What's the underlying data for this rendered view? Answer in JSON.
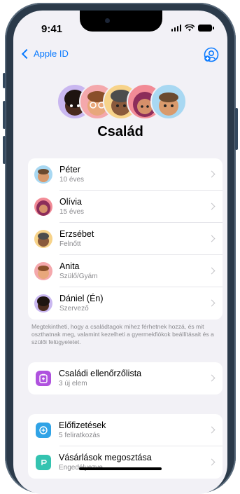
{
  "status_bar": {
    "time": "9:41"
  },
  "nav": {
    "back_label": "Apple ID"
  },
  "page": {
    "title": "Család"
  },
  "members": [
    {
      "name": "Péter",
      "detail": "10 éves"
    },
    {
      "name": "Olívia",
      "detail": "15 éves"
    },
    {
      "name": "Erzsébet",
      "detail": "Felnőtt"
    },
    {
      "name": "Anita",
      "detail": "Szülő/Gyám"
    },
    {
      "name": "Dániel (Én)",
      "detail": "Szervező"
    }
  ],
  "footnote": "Megtekintheti, hogy a családtagok mihez férhetnek hozzá, és mit oszthatnak meg, valamint kezelheti a gyermekfiókok beállításait és a szülői felügyeletet.",
  "checklist": {
    "title": "Családi ellenőrzőlista",
    "detail": "3 új elem"
  },
  "subscriptions": {
    "title": "Előfizetések",
    "detail": "5 feliratkozás"
  },
  "purchases": {
    "title": "Vásárlások megosztása",
    "detail": "Engedélyezve"
  },
  "colors": {
    "accent": "#0a7aff",
    "checklist_icon": "#af52de",
    "subscriptions_icon": "#30a3e6",
    "purchases_icon": "#34c3b0"
  }
}
